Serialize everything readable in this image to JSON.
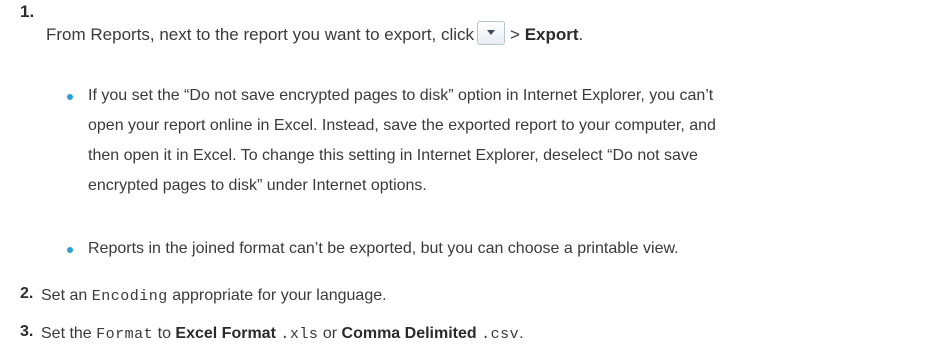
{
  "steps": [
    {
      "number": "1.",
      "text_before": "From Reports, next to the report you want to export, click",
      "separator": ">",
      "action": "Export",
      "text_after": ".",
      "bullets": [
        {
          "lines": [
            "If you set the “Do not save encrypted pages to disk” option in Internet Explorer, you can’t",
            "open your report online in Excel. Instead, save the exported report to your computer, and",
            "then open it in Excel. To change this setting in Internet Explorer, deselect “Do not save",
            "encrypted pages to disk” under Internet options."
          ]
        },
        {
          "lines": [
            "Reports in the joined format can’t be exported, but you can choose a printable view."
          ]
        }
      ]
    },
    {
      "number": "2.",
      "text_before": "Set an",
      "code": "Encoding",
      "text_after": "appropriate for your language."
    },
    {
      "number": "3.",
      "text_before": "Set the",
      "code": "Format",
      "text_mid": "to",
      "option1_bold": "Excel Format",
      "option1_code": ".xls",
      "or_text": "or",
      "option2_bold": "Comma Delimited",
      "option2_code": ".csv",
      "text_after": "."
    }
  ],
  "icons": {
    "dropdown_button": "chevron-down-icon"
  },
  "colors": {
    "bullet": "#2a9fd8",
    "text": "#3a3a3a"
  }
}
